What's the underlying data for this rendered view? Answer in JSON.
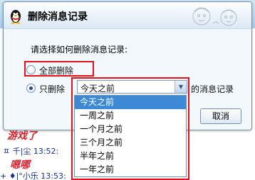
{
  "dialog": {
    "title": "删除消息记录",
    "prompt": "请选择如何删除消息记录:",
    "option_all": "全部删除",
    "option_partial_prefix": "只删除",
    "option_partial_suffix": "的消息记录",
    "selected_option": "option_partial",
    "cancel_label": "取消"
  },
  "dropdown": {
    "value": "今天之前",
    "items": [
      "今天之前",
      "一周之前",
      "一个月之前",
      "三个月之前",
      "半年之前",
      "一年之前"
    ],
    "selected_index": 0
  },
  "chat": {
    "line1": "游戏了",
    "line2": "ㅍ 千|尘 13:52:",
    "line3": "嗯哪",
    "line4": "+ ♦|°小乐 13:53:"
  },
  "colors": {
    "highlight_red": "#e4101c",
    "selection_blue": "#3e89d6",
    "chat_red": "#e0202a",
    "chat_blue": "#16309a"
  }
}
